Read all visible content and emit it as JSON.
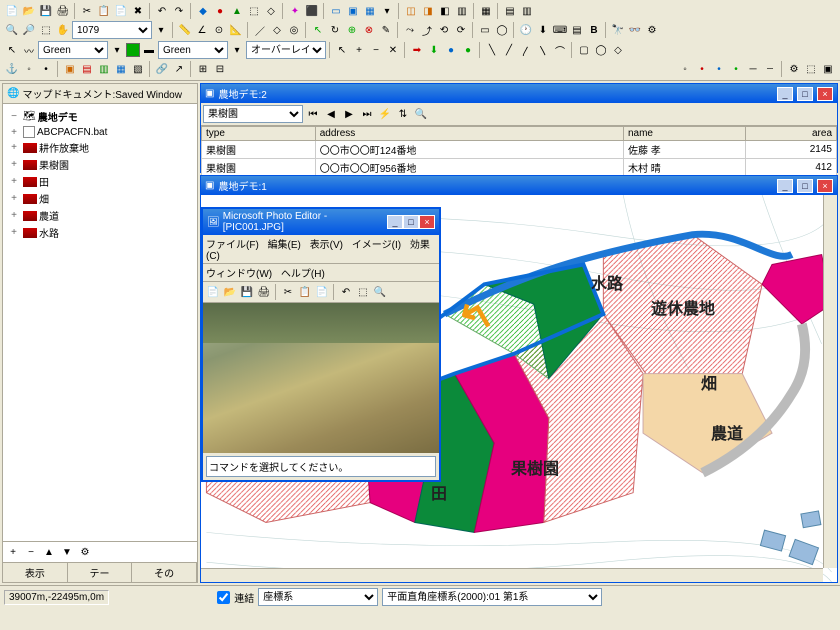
{
  "toolbars": {
    "zoom_value": "1079",
    "color1_label": "Green",
    "color2_label": "Green",
    "overlay_label": "オーバーレイ"
  },
  "tree_panel": {
    "title": "マップドキュメント:Saved Window",
    "root": "農地デモ",
    "items": [
      {
        "label": "ABCPACFN.bat",
        "kind": "file"
      },
      {
        "label": "耕作放棄地",
        "kind": "layer"
      },
      {
        "label": "果樹園",
        "kind": "layer"
      },
      {
        "label": "田",
        "kind": "layer"
      },
      {
        "label": "畑",
        "kind": "layer"
      },
      {
        "label": "農道",
        "kind": "layer"
      },
      {
        "label": "水路",
        "kind": "layer"
      }
    ],
    "tabs": [
      "表示",
      "テー",
      "その"
    ]
  },
  "table_window": {
    "title": "農地デモ:2",
    "dropdown": "果樹園",
    "columns": [
      "type",
      "address",
      "name",
      "area"
    ],
    "rows": [
      {
        "type": "果樹園",
        "address": "〇〇市〇〇町124番地",
        "name": "佐藤 孝",
        "area": "2145"
      },
      {
        "type": "果樹園",
        "address": "〇〇市〇〇町956番地",
        "name": "木村 晴",
        "area": "412"
      }
    ]
  },
  "map_window": {
    "title": "農地デモ:1",
    "labels": {
      "suiro": "水路",
      "yukyufarm": "遊休農地",
      "hatake": "畑",
      "noudou": "農道",
      "kajuen": "果樹園",
      "ta": "田"
    }
  },
  "photo_editor": {
    "title": "Microsoft Photo Editor - [PIC001.JPG]",
    "menu": [
      "ファイル(F)",
      "編集(E)",
      "表示(V)",
      "イメージ(I)",
      "効果(C)"
    ],
    "menu2": [
      "ウィンドウ(W)",
      "ヘルプ(H)"
    ],
    "command_hint": "コマンドを選択してください。"
  },
  "status": {
    "coords": "39007m,-22495m,0m",
    "check_label": "連結",
    "combo1": "座標系",
    "combo2": "平面直角座標系(2000):01 第1系"
  }
}
